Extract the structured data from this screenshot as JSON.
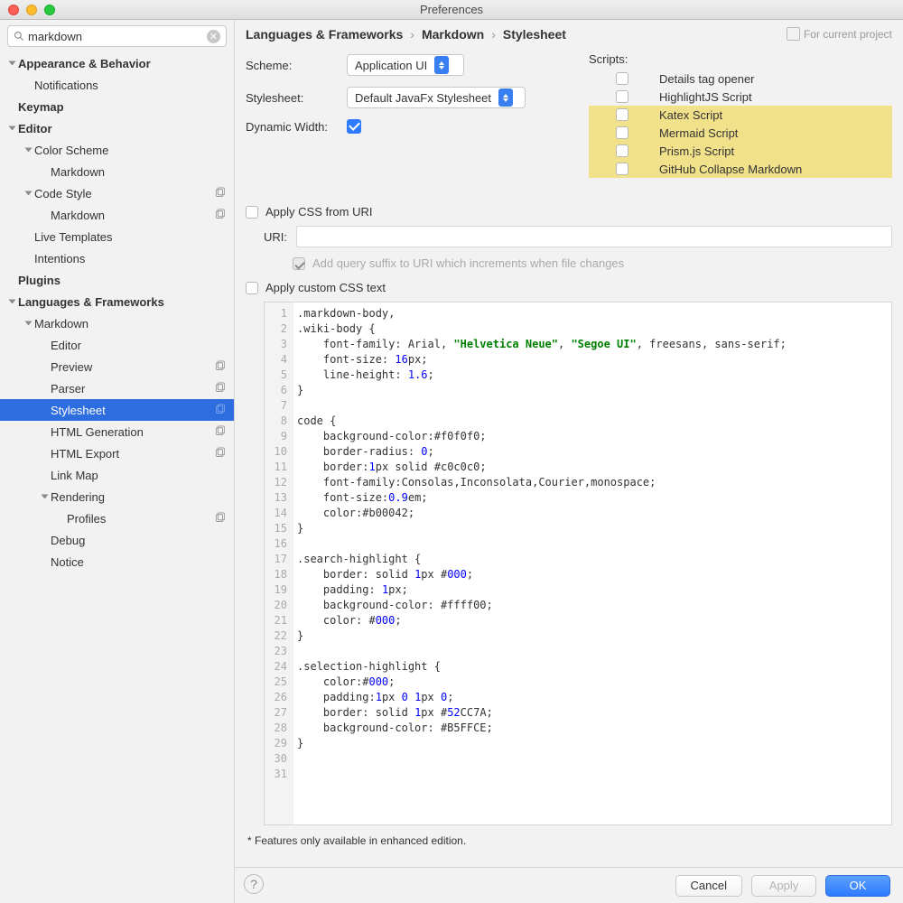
{
  "window": {
    "title": "Preferences"
  },
  "search": {
    "value": "markdown"
  },
  "tree": [
    {
      "label": "Appearance & Behavior",
      "indent": 0,
      "bold": true,
      "chev": "open"
    },
    {
      "label": "Notifications",
      "indent": 1
    },
    {
      "label": "Keymap",
      "indent": 0,
      "bold": true
    },
    {
      "label": "Editor",
      "indent": 0,
      "bold": true,
      "chev": "open"
    },
    {
      "label": "Color Scheme",
      "indent": 1,
      "chev": "open"
    },
    {
      "label": "Markdown",
      "indent": 2
    },
    {
      "label": "Code Style",
      "indent": 1,
      "chev": "open",
      "copy": true
    },
    {
      "label": "Markdown",
      "indent": 2,
      "copy": true
    },
    {
      "label": "Live Templates",
      "indent": 1
    },
    {
      "label": "Intentions",
      "indent": 1
    },
    {
      "label": "Plugins",
      "indent": 0,
      "bold": true
    },
    {
      "label": "Languages & Frameworks",
      "indent": 0,
      "bold": true,
      "chev": "open"
    },
    {
      "label": "Markdown",
      "indent": 1,
      "chev": "open"
    },
    {
      "label": "Editor",
      "indent": 2
    },
    {
      "label": "Preview",
      "indent": 2,
      "copy": true
    },
    {
      "label": "Parser",
      "indent": 2,
      "copy": true
    },
    {
      "label": "Stylesheet",
      "indent": 2,
      "copy": true,
      "selected": true
    },
    {
      "label": "HTML Generation",
      "indent": 2,
      "copy": true
    },
    {
      "label": "HTML Export",
      "indent": 2,
      "copy": true
    },
    {
      "label": "Link Map",
      "indent": 2
    },
    {
      "label": "Rendering",
      "indent": 2,
      "chev": "open"
    },
    {
      "label": "Profiles",
      "indent": 3,
      "copy": true
    },
    {
      "label": "Debug",
      "indent": 2
    },
    {
      "label": "Notice",
      "indent": 2
    }
  ],
  "breadcrumb": [
    "Languages & Frameworks",
    "Markdown",
    "Stylesheet"
  ],
  "project_hint": "For current project",
  "form": {
    "scheme_label": "Scheme:",
    "scheme_value": "Application UI",
    "stylesheet_label": "Stylesheet:",
    "stylesheet_value": "Default JavaFx Stylesheet",
    "dynamic_width_label": "Dynamic Width:",
    "dynamic_width_checked": true
  },
  "scripts": {
    "header": "Scripts:",
    "items": [
      {
        "label": "Details tag opener",
        "hl": false
      },
      {
        "label": "HighlightJS Script",
        "hl": false
      },
      {
        "label": "Katex Script",
        "hl": true
      },
      {
        "label": "Mermaid Script",
        "hl": true
      },
      {
        "label": "Prism.js Script",
        "hl": true
      },
      {
        "label": "GitHub Collapse Markdown",
        "hl": true
      }
    ]
  },
  "css_uri": {
    "apply_label": "Apply CSS from URI",
    "uri_label": "URI:",
    "suffix_label": "Add query suffix to URI which increments when file changes",
    "suffix_checked": true
  },
  "custom_css": {
    "apply_label": "Apply custom CSS text"
  },
  "code_lines": [
    [
      [
        "sel",
        ".markdown-body,"
      ]
    ],
    [
      [
        "sel",
        ".wiki-body {"
      ]
    ],
    [
      [
        "pad",
        "    "
      ],
      [
        "prop",
        "font-family: Arial, "
      ],
      [
        "str",
        "\"Helvetica Neue\""
      ],
      [
        "prop",
        ", "
      ],
      [
        "str",
        "\"Segoe UI\""
      ],
      [
        "prop",
        ", freesans, sans-serif;"
      ]
    ],
    [
      [
        "pad",
        "    "
      ],
      [
        "prop",
        "font-size: "
      ],
      [
        "num",
        "16"
      ],
      [
        "prop",
        "px;"
      ]
    ],
    [
      [
        "pad",
        "    "
      ],
      [
        "prop",
        "line-height: "
      ],
      [
        "num",
        "1.6"
      ],
      [
        "prop",
        ";"
      ]
    ],
    [
      [
        "sel",
        "}"
      ]
    ],
    [],
    [
      [
        "sel",
        "code {"
      ]
    ],
    [
      [
        "pad",
        "    "
      ],
      [
        "prop",
        "background-color:#f0f0f0;"
      ]
    ],
    [
      [
        "pad",
        "    "
      ],
      [
        "prop",
        "border-radius: "
      ],
      [
        "num",
        "0"
      ],
      [
        "prop",
        ";"
      ]
    ],
    [
      [
        "pad",
        "    "
      ],
      [
        "prop",
        "border:"
      ],
      [
        "num",
        "1"
      ],
      [
        "prop",
        "px solid #c0c0c0;"
      ]
    ],
    [
      [
        "pad",
        "    "
      ],
      [
        "prop",
        "font-family:Consolas,Inconsolata,Courier,monospace;"
      ]
    ],
    [
      [
        "pad",
        "    "
      ],
      [
        "prop",
        "font-size:"
      ],
      [
        "num",
        "0.9"
      ],
      [
        "prop",
        "em;"
      ]
    ],
    [
      [
        "pad",
        "    "
      ],
      [
        "prop",
        "color:#b00042;"
      ]
    ],
    [
      [
        "sel",
        "}"
      ]
    ],
    [],
    [
      [
        "sel",
        ".search-highlight {"
      ]
    ],
    [
      [
        "pad",
        "    "
      ],
      [
        "prop",
        "border: solid "
      ],
      [
        "num",
        "1"
      ],
      [
        "prop",
        "px #"
      ],
      [
        "num",
        "000"
      ],
      [
        "prop",
        ";"
      ]
    ],
    [
      [
        "pad",
        "    "
      ],
      [
        "prop",
        "padding: "
      ],
      [
        "num",
        "1"
      ],
      [
        "prop",
        "px;"
      ]
    ],
    [
      [
        "pad",
        "    "
      ],
      [
        "prop",
        "background-color: #ffff00;"
      ]
    ],
    [
      [
        "pad",
        "    "
      ],
      [
        "prop",
        "color: #"
      ],
      [
        "num",
        "000"
      ],
      [
        "prop",
        ";"
      ]
    ],
    [
      [
        "sel",
        "}"
      ]
    ],
    [],
    [
      [
        "sel",
        ".selection-highlight {"
      ]
    ],
    [
      [
        "pad",
        "    "
      ],
      [
        "prop",
        "color:#"
      ],
      [
        "num",
        "000"
      ],
      [
        "prop",
        ";"
      ]
    ],
    [
      [
        "pad",
        "    "
      ],
      [
        "prop",
        "padding:"
      ],
      [
        "num",
        "1"
      ],
      [
        "prop",
        "px "
      ],
      [
        "num",
        "0"
      ],
      [
        "prop",
        " "
      ],
      [
        "num",
        "1"
      ],
      [
        "prop",
        "px "
      ],
      [
        "num",
        "0"
      ],
      [
        "prop",
        ";"
      ]
    ],
    [
      [
        "pad",
        "    "
      ],
      [
        "prop",
        "border: solid "
      ],
      [
        "num",
        "1"
      ],
      [
        "prop",
        "px #"
      ],
      [
        "num",
        "52"
      ],
      [
        "prop",
        "CC7A;"
      ]
    ],
    [
      [
        "pad",
        "    "
      ],
      [
        "prop",
        "background-color: #B5FFCE;"
      ]
    ],
    [
      [
        "sel",
        "}"
      ]
    ],
    [],
    []
  ],
  "footer_note": "* Features only available in enhanced edition.",
  "buttons": {
    "cancel": "Cancel",
    "apply": "Apply",
    "ok": "OK"
  }
}
